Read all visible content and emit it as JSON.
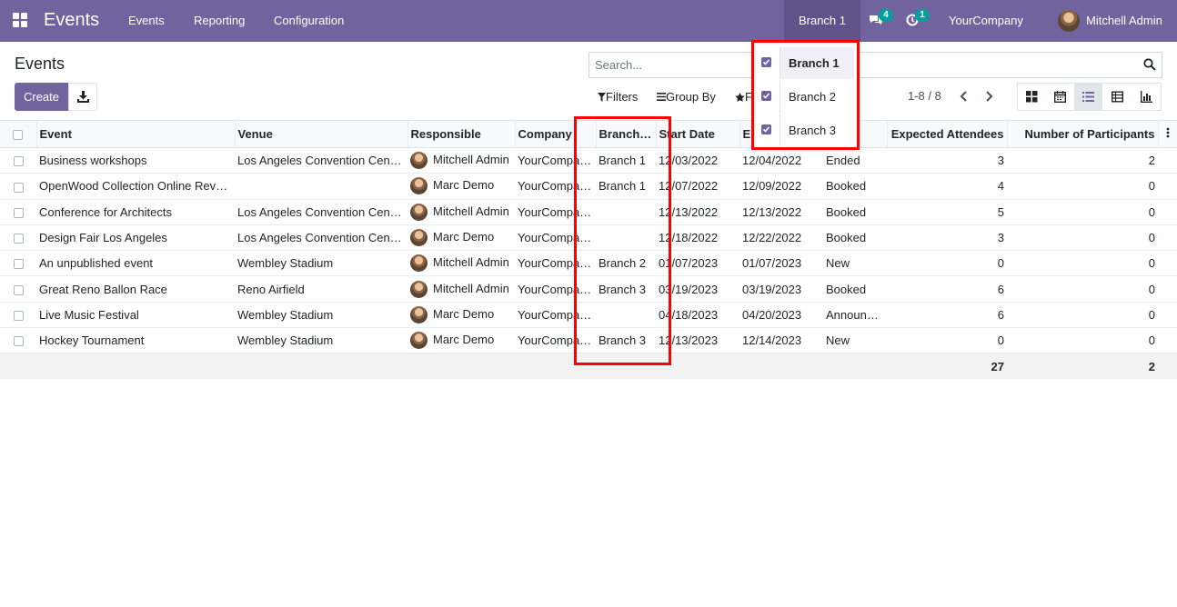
{
  "navbar": {
    "brand": "Events",
    "menu": [
      "Events",
      "Reporting",
      "Configuration"
    ],
    "branch": "Branch 1",
    "messages_count": "4",
    "activities_count": "1",
    "company": "YourCompany",
    "user": "Mitchell Admin",
    "bg_color": "#71639e"
  },
  "control": {
    "title": "Events",
    "create_label": "Create",
    "search_placeholder": "Search...",
    "filters_label": "Filters",
    "groupby_label": "Group By",
    "favorites_label": "F",
    "pager": "1-8 / 8"
  },
  "table": {
    "headers": [
      "Event",
      "Venue",
      "Responsible",
      "Company",
      "Branch…",
      "Start Date",
      "E",
      "",
      "Expected Attendees",
      "Number of Participants"
    ],
    "rows": [
      [
        "Business workshops",
        "Los Angeles Convention Cen…",
        "Mitchell Admin",
        "YourCompa…",
        "Branch 1",
        "12/03/2022",
        "12/04/2022",
        "Ended",
        "3",
        "2"
      ],
      [
        "OpenWood Collection Online Rev…",
        "",
        "Marc Demo",
        "YourCompa…",
        "Branch 1",
        "12/07/2022",
        "12/09/2022",
        "Booked",
        "4",
        "0"
      ],
      [
        "Conference for Architects",
        "Los Angeles Convention Cen…",
        "Mitchell Admin",
        "YourCompa…",
        "",
        "12/13/2022",
        "12/13/2022",
        "Booked",
        "5",
        "0"
      ],
      [
        "Design Fair Los Angeles",
        "Los Angeles Convention Cen…",
        "Marc Demo",
        "YourCompa…",
        "",
        "12/18/2022",
        "12/22/2022",
        "Booked",
        "3",
        "0"
      ],
      [
        "An unpublished event",
        "Wembley Stadium",
        "Mitchell Admin",
        "YourCompa…",
        "Branch 2",
        "01/07/2023",
        "01/07/2023",
        "New",
        "0",
        "0"
      ],
      [
        "Great Reno Ballon Race",
        "Reno Airfield",
        "Mitchell Admin",
        "YourCompa…",
        "Branch 3",
        "03/19/2023",
        "03/19/2023",
        "Booked",
        "6",
        "0"
      ],
      [
        "Live Music Festival",
        "Wembley Stadium",
        "Marc Demo",
        "YourCompa…",
        "",
        "04/18/2023",
        "04/20/2023",
        "Announced",
        "6",
        "0"
      ],
      [
        "Hockey Tournament",
        "Wembley Stadium",
        "Marc Demo",
        "YourCompa…",
        "Branch 3",
        "12/13/2023",
        "12/14/2023",
        "New",
        "0",
        "0"
      ]
    ],
    "totals": {
      "expected": "27",
      "participants": "2"
    }
  },
  "branch_dropdown": {
    "items": [
      {
        "label": "Branch 1",
        "checked": true,
        "active": true
      },
      {
        "label": "Branch 2",
        "checked": true,
        "active": false
      },
      {
        "label": "Branch 3",
        "checked": true,
        "active": false
      }
    ]
  },
  "highlight_color": "#ff0000"
}
